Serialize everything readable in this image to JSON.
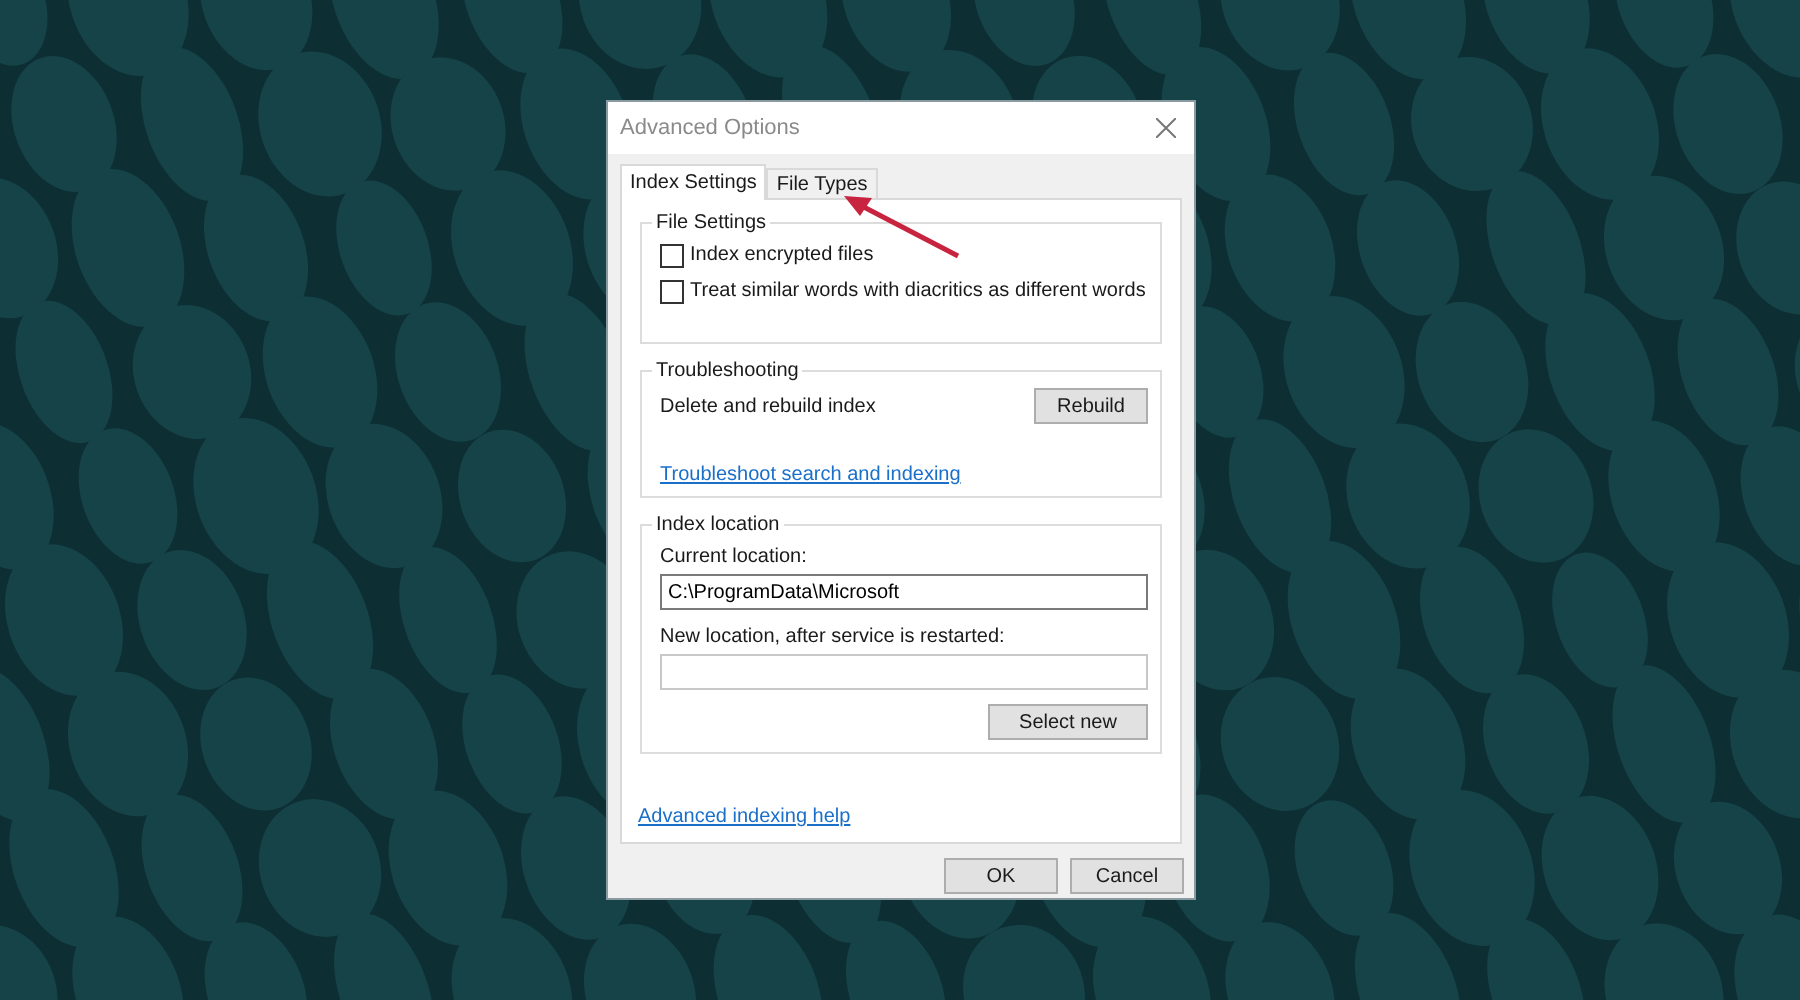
{
  "window": {
    "title": "Advanced Options"
  },
  "tabs": [
    {
      "label": "Index Settings",
      "selected": true
    },
    {
      "label": "File Types",
      "selected": false
    }
  ],
  "file_settings": {
    "title": "File Settings",
    "options": [
      {
        "label": "Index encrypted files",
        "checked": false
      },
      {
        "label": "Treat similar words with diacritics as different words",
        "checked": false
      }
    ]
  },
  "troubleshooting": {
    "title": "Troubleshooting",
    "label": "Delete and rebuild index",
    "button": "Rebuild",
    "link": "Troubleshoot search and indexing"
  },
  "index_location": {
    "title": "Index location",
    "current_label": "Current location:",
    "current_value": "C:\\ProgramData\\Microsoft",
    "new_label": "New location, after service is restarted:",
    "button": "Select new"
  },
  "help_link": "Advanced indexing help",
  "buttons": [
    "OK",
    "Cancel"
  ]
}
